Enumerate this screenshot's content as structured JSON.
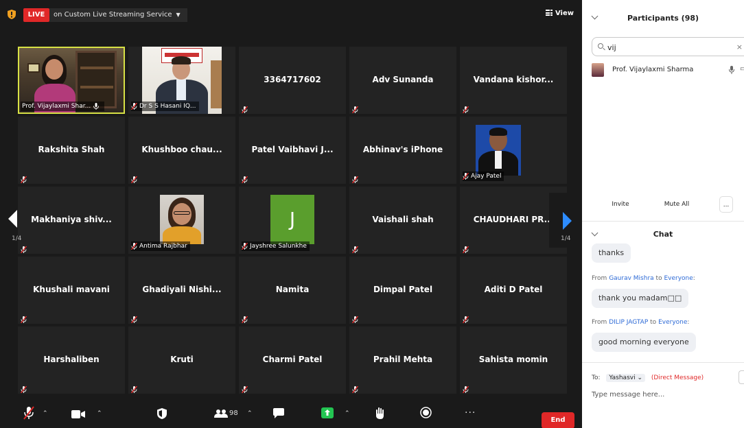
{
  "topbar": {
    "live_label": "LIVE",
    "stream_label": "on Custom Live Streaming Service",
    "view_label": "View"
  },
  "tiles": [
    {
      "name": "",
      "label": "Prof. Vijaylaxmi Shar...",
      "video": "vijaylaxmi",
      "muted": false,
      "active": true
    },
    {
      "name": "",
      "label": "Dr S S Hasani IQ...",
      "video": "hasani",
      "muted": true
    },
    {
      "name": "3364717602",
      "muted": true
    },
    {
      "name": "Adv Sunanda",
      "muted": true
    },
    {
      "name": "Vandana  kishor...",
      "muted": true
    },
    {
      "name": "Rakshita Shah",
      "muted": true
    },
    {
      "name": "Khushboo  chau...",
      "muted": true
    },
    {
      "name": "Patel Vaibhavi J...",
      "muted": true
    },
    {
      "name": "Abhinav's iPhone",
      "muted": true
    },
    {
      "name": "",
      "label": "Ajay Patel",
      "video": "ajay",
      "muted": true
    },
    {
      "name": "Makhaniya  shiv...",
      "muted": true
    },
    {
      "name": "",
      "label": "Antima Rajbhar",
      "video": "antima",
      "muted": true
    },
    {
      "name": "",
      "label": "Jayshree Salunkhe",
      "avatar_letter": "J",
      "muted": true
    },
    {
      "name": "Vaishali shah",
      "muted": true
    },
    {
      "name": "CHAUDHARI  PR...",
      "muted": true
    },
    {
      "name": "Khushali mavani",
      "muted": true
    },
    {
      "name": "Ghadiyali  Nishi...",
      "muted": true
    },
    {
      "name": "Namita",
      "muted": true
    },
    {
      "name": "Dimpal Patel",
      "muted": true
    },
    {
      "name": "Aditi D Patel",
      "muted": true
    },
    {
      "name": "Harshaliben",
      "muted": true
    },
    {
      "name": "Kruti",
      "muted": true
    },
    {
      "name": "Charmi Patel",
      "muted": true
    },
    {
      "name": "Prahil Mehta",
      "muted": true
    },
    {
      "name": "Sahista momin",
      "muted": true
    }
  ],
  "pager": {
    "left": "1/4",
    "right": "1/4"
  },
  "toolbar": {
    "participants_count": "98",
    "end_label": "End"
  },
  "participants": {
    "title": "Participants (98)",
    "search_value": "vij",
    "results": [
      {
        "name": "Prof. Vijaylaxmi Sharma"
      }
    ],
    "invite_label": "Invite",
    "mute_all_label": "Mute All",
    "more_label": "..."
  },
  "chat": {
    "title": "Chat",
    "messages": [
      {
        "text": "thanks"
      },
      {
        "from": "Gaurav Mishra",
        "to": "Everyone",
        "text": "thank you madam□□"
      },
      {
        "from": "DILIP JAGTAP",
        "to": "Everyone",
        "text": "good morning everyone"
      }
    ],
    "from_word": "From",
    "to_word": "to",
    "to_label": "To:",
    "recipient": "Yashasvi",
    "dm_label": "(Direct Message)",
    "input_placeholder": "Type message here..."
  },
  "colors": {
    "live_red": "#e02828",
    "active_border": "#d8e245",
    "accent_blue": "#2d8cff",
    "share_green": "#23c552"
  }
}
